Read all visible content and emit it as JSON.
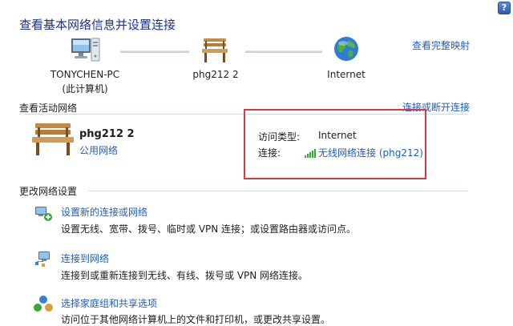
{
  "header": {
    "title": "查看基本网络信息并设置连接",
    "map_link": "查看完整映射",
    "help_icon": "?"
  },
  "network_map": {
    "nodes": [
      {
        "label_line1": "TONYCHEN-PC",
        "label_line2": "(此计算机)",
        "icon": "computer-icon"
      },
      {
        "label_line1": "phg212  2",
        "icon": "bench-icon"
      },
      {
        "label_line1": "Internet",
        "icon": "globe-icon"
      }
    ]
  },
  "active_networks": {
    "section_title": "查看活动网络",
    "connect_link": "连接或断开连接",
    "network_name": "phg212  2",
    "network_type": "公用网络",
    "access_type_label": "访问类型:",
    "access_type_value": "Internet",
    "connection_label": "连接:",
    "connection_value": "无线网络连接 (phg212)"
  },
  "change_settings": {
    "section_title": "更改网络设置",
    "tasks": [
      {
        "link": "设置新的连接或网络",
        "desc": "设置无线、宽带、拨号、临时或 VPN 连接；或设置路由器或访问点。",
        "icon": "new-connection-icon"
      },
      {
        "link": "连接到网络",
        "desc": "连接到或重新连接到无线、有线、拨号或 VPN 网络连接。",
        "icon": "connect-network-icon"
      },
      {
        "link": "选择家庭组和共享选项",
        "desc": "访问位于其他网络计算机上的文件和打印机，或更改共享设置。",
        "icon": "homegroup-icon"
      }
    ]
  },
  "colors": {
    "title": "#1e3287",
    "link": "#1f5fb8",
    "highlight": "#d73a3a"
  }
}
